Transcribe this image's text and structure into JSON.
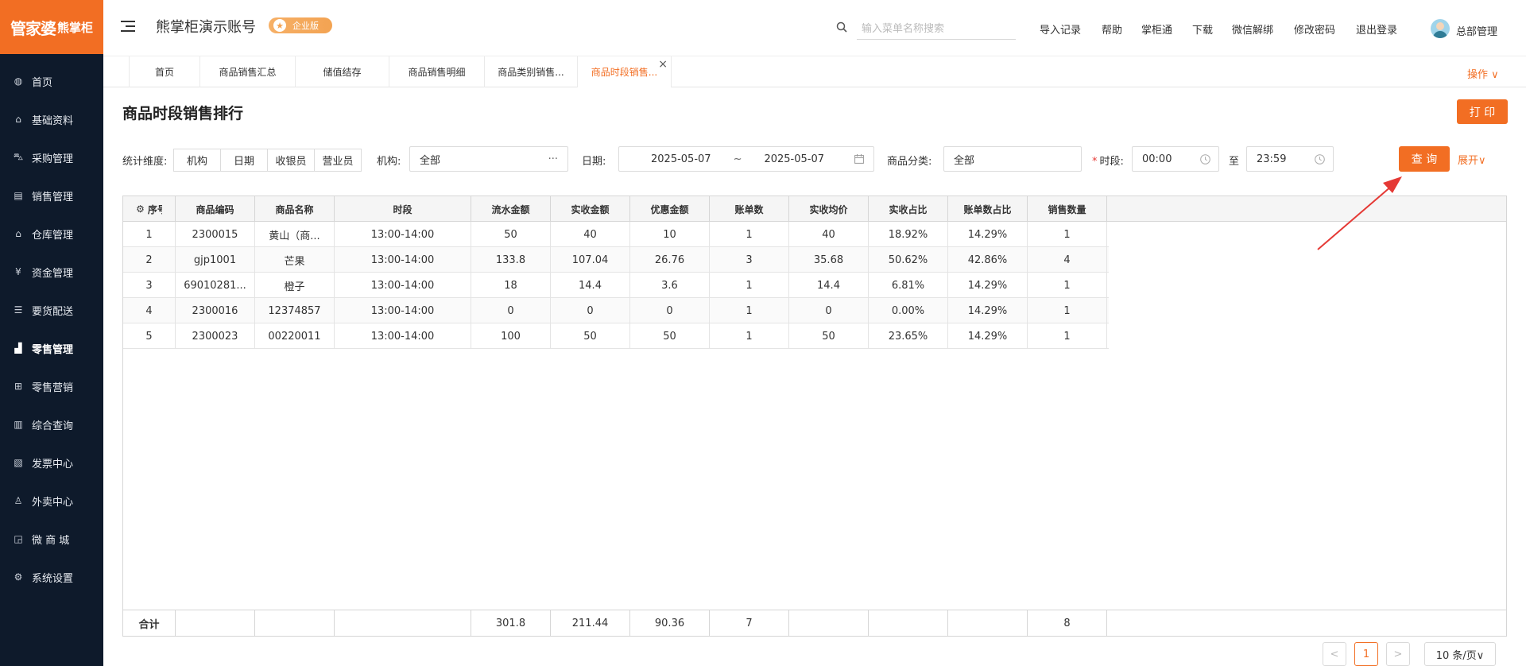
{
  "logo": {
    "brand_cn": "管家婆",
    "sub_cn": "熊掌柜"
  },
  "sidebar": {
    "items": [
      {
        "label": "首页",
        "icon": "globe-icon"
      },
      {
        "label": "基础资料",
        "icon": "home-icon"
      },
      {
        "label": "采购管理",
        "icon": "cart-icon"
      },
      {
        "label": "销售管理",
        "icon": "sales-icon"
      },
      {
        "label": "仓库管理",
        "icon": "warehouse-icon"
      },
      {
        "label": "资金管理",
        "icon": "yen-icon"
      },
      {
        "label": "要货配送",
        "icon": "list-icon"
      },
      {
        "label": "零售管理",
        "icon": "chart-icon"
      },
      {
        "label": "零售营销",
        "icon": "gift-icon"
      },
      {
        "label": "综合查询",
        "icon": "bar-chart-icon"
      },
      {
        "label": "发票中心",
        "icon": "invoice-icon"
      },
      {
        "label": "外卖中心",
        "icon": "delivery-icon"
      },
      {
        "label": "微 商 城",
        "icon": "bag-icon"
      },
      {
        "label": "系统设置",
        "icon": "gear-icon"
      }
    ],
    "active": "零售管理"
  },
  "header": {
    "account_name": "熊掌柜演示账号",
    "badge": "企业版",
    "search_placeholder": "输入菜单名称搜索",
    "links": [
      "导入记录",
      "帮助",
      "掌柜通",
      "下载",
      "微信解绑",
      "修改密码",
      "退出登录"
    ],
    "user": "总部管理"
  },
  "tabs": {
    "items": [
      "首页",
      "商品销售汇总",
      "储值结存",
      "商品销售明细",
      "商品类别销售...",
      "商品时段销售..."
    ],
    "active_index": 5,
    "ops_label": "操作 ∨"
  },
  "page": {
    "title": "商品时段销售排行",
    "print_label": "打 印"
  },
  "filters": {
    "dimension_label": "统计维度:",
    "dimension_options": [
      "机构",
      "日期",
      "收银员",
      "营业员"
    ],
    "org_label": "机构:",
    "org_value": "全部",
    "org_more": "···",
    "date_label": "日期:",
    "date_start": "2025-05-07",
    "date_sep": "~",
    "date_end": "2025-05-07",
    "category_label": "商品分类:",
    "category_value": "全部",
    "period_required": "*",
    "period_label": "时段:",
    "period_start": "00:00",
    "period_to": "至",
    "period_end": "23:59",
    "query_label": "查 询",
    "expand_label": "展开∨"
  },
  "table": {
    "columns": [
      "序号",
      "商品编码",
      "商品名称",
      "时段",
      "流水金额",
      "实收金额",
      "优惠金额",
      "账单数",
      "实收均价",
      "实收占比",
      "账单数占比",
      "销售数量"
    ],
    "rows": [
      [
        "1",
        "2300015",
        "黄山（商...",
        "13:00-14:00",
        "50",
        "40",
        "10",
        "1",
        "40",
        "18.92%",
        "14.29%",
        "1"
      ],
      [
        "2",
        "gjp1001",
        "芒果",
        "13:00-14:00",
        "133.8",
        "107.04",
        "26.76",
        "3",
        "35.68",
        "50.62%",
        "42.86%",
        "4"
      ],
      [
        "3",
        "69010281...",
        "橙子",
        "13:00-14:00",
        "18",
        "14.4",
        "3.6",
        "1",
        "14.4",
        "6.81%",
        "14.29%",
        "1"
      ],
      [
        "4",
        "2300016",
        "12374857",
        "13:00-14:00",
        "0",
        "0",
        "0",
        "1",
        "0",
        "0.00%",
        "14.29%",
        "1"
      ],
      [
        "5",
        "2300023",
        "00220011",
        "13:00-14:00",
        "100",
        "50",
        "50",
        "1",
        "50",
        "23.65%",
        "14.29%",
        "1"
      ]
    ],
    "footer": [
      "合计",
      "",
      "",
      "",
      "301.8",
      "211.44",
      "90.36",
      "7",
      "",
      "",
      "",
      "8"
    ]
  },
  "pagination": {
    "prev": "<",
    "current": "1",
    "next": ">",
    "page_size": "10 条/页∨"
  },
  "colors": {
    "accent": "#f26e23",
    "sidebar_bg": "#0e1a2b"
  }
}
